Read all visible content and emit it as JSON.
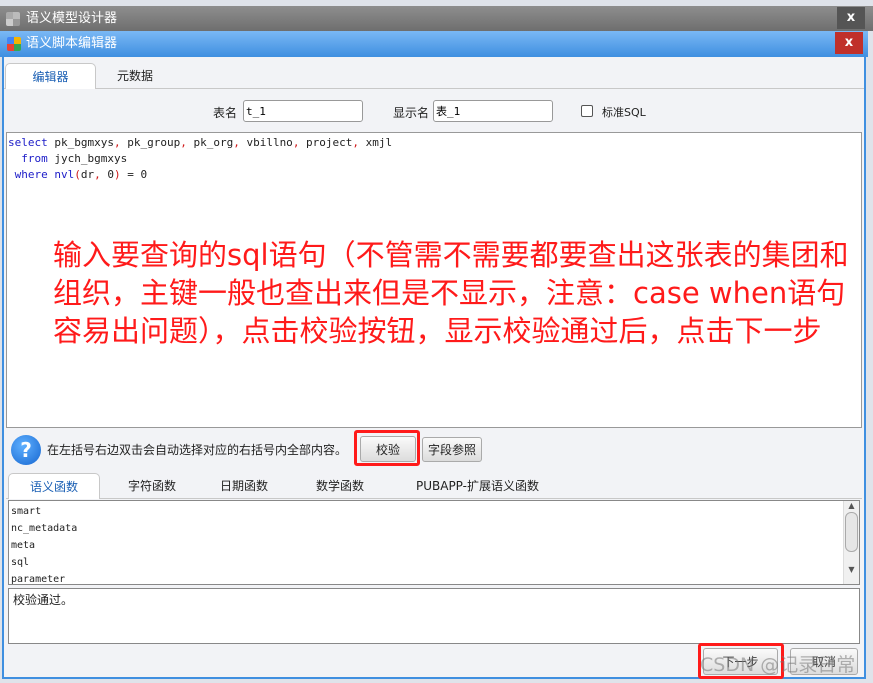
{
  "outer_window": {
    "title": "语义模型设计器",
    "close": "x"
  },
  "dialog": {
    "title": "语义脚本编辑器",
    "close": "x"
  },
  "tabs": [
    "编辑器",
    "元数据"
  ],
  "fields": {
    "table_name_label": "表名",
    "table_name_value": "t_1",
    "display_name_label": "显示名",
    "display_name_value": "表_1",
    "standard_sql_label": "标准SQL",
    "standard_sql_checked": false
  },
  "sql_lines": [
    [
      {
        "t": "select",
        "c": "kw"
      },
      {
        "t": " pk_bgmxys"
      },
      {
        "t": ",",
        "c": "pn"
      },
      {
        "t": " pk_group"
      },
      {
        "t": ",",
        "c": "pn"
      },
      {
        "t": " pk_org"
      },
      {
        "t": ",",
        "c": "pn"
      },
      {
        "t": " vbillno"
      },
      {
        "t": ",",
        "c": "pn"
      },
      {
        "t": " project"
      },
      {
        "t": ",",
        "c": "pn"
      },
      {
        "t": " xmjl"
      }
    ],
    [
      {
        "t": "  "
      },
      {
        "t": "from",
        "c": "kw"
      },
      {
        "t": " jych_bgmxys"
      }
    ],
    [
      {
        "t": " "
      },
      {
        "t": "where",
        "c": "kw"
      },
      {
        "t": " "
      },
      {
        "t": "nvl",
        "c": "kw"
      },
      {
        "t": "(",
        "c": "pn"
      },
      {
        "t": "dr"
      },
      {
        "t": ",",
        "c": "pn"
      },
      {
        "t": " 0"
      },
      {
        "t": ")",
        "c": "pn"
      },
      {
        "t": " = 0"
      }
    ]
  ],
  "annotation": "输入要查询的sql语句（不管需不需要都要查出这张表的集团和组织，主键一般也查出来但是不显示，注意：case when语句容易出问题），点击校验按钮，显示校验通过后，点击下一步",
  "help_text": "在左括号右边双击会自动选择对应的右括号内全部内容。",
  "buttons": {
    "validate": "校验",
    "field_ref": "字段参照",
    "next": "下一步",
    "cancel": "取消"
  },
  "function_tabs": [
    "语义函数",
    "字符函数",
    "日期函数",
    "数学函数",
    "PUBAPP-扩展语义函数"
  ],
  "function_items": [
    "smart",
    "nc_metadata",
    "meta",
    "sql",
    "parameter"
  ],
  "message": "校验通过。",
  "watermark": "CSDN @记录日常",
  "colors": {
    "accent_blue": "#3f8fe0",
    "highlight_red": "#ff1a1a",
    "close_red": "#c0302a"
  }
}
